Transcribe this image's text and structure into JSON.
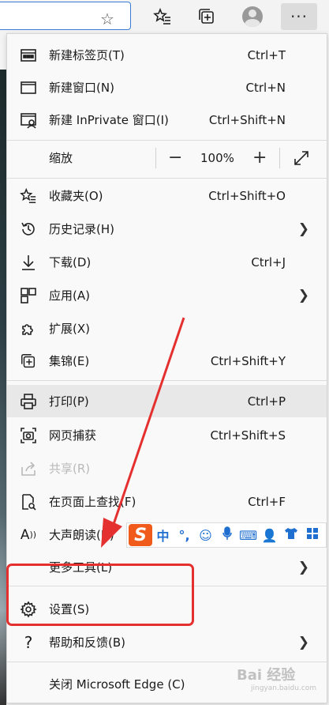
{
  "toolbar": {
    "favorites_star": "☆",
    "more_button": "···"
  },
  "menu": {
    "new_tab": {
      "label": "新建标签页(T)",
      "shortcut": "Ctrl+T"
    },
    "new_window": {
      "label": "新建窗口(N)",
      "shortcut": "Ctrl+N"
    },
    "new_inprivate": {
      "label": "新建 InPrivate 窗口(I)",
      "shortcut": "Ctrl+Shift+N"
    },
    "zoom": {
      "label": "缩放",
      "value": "100%",
      "minus": "−",
      "plus": "+"
    },
    "favorites": {
      "label": "收藏夹(O)",
      "shortcut": "Ctrl+Shift+O"
    },
    "history": {
      "label": "历史记录(H)"
    },
    "downloads": {
      "label": "下载(D)",
      "shortcut": "Ctrl+J"
    },
    "apps": {
      "label": "应用(A)"
    },
    "extensions": {
      "label": "扩展(X)"
    },
    "collections": {
      "label": "集锦(E)",
      "shortcut": "Ctrl+Shift+Y"
    },
    "print": {
      "label": "打印(P)",
      "shortcut": "Ctrl+P"
    },
    "web_capture": {
      "label": "网页捕获",
      "shortcut": "Ctrl+Shift+S"
    },
    "share": {
      "label": "共享(R)"
    },
    "find": {
      "label": "在页面上查找(F)",
      "shortcut": "Ctrl+F"
    },
    "read_aloud": {
      "label": "大声朗读(U)"
    },
    "more_tools": {
      "label": "更多工具(L)"
    },
    "settings": {
      "label": "设置(S)"
    },
    "help": {
      "label": "帮助和反馈(B)"
    },
    "close": {
      "label": "关闭 Microsoft Edge (C)"
    }
  },
  "ime": {
    "logo": "S",
    "chinese": "中"
  },
  "watermark": {
    "text": "Bai 经验",
    "url": "jingyan.baidu.com"
  },
  "colors": {
    "annotation": "#e53030",
    "ime_logo": "#f05a1a",
    "accent": "#3a7bd5"
  }
}
